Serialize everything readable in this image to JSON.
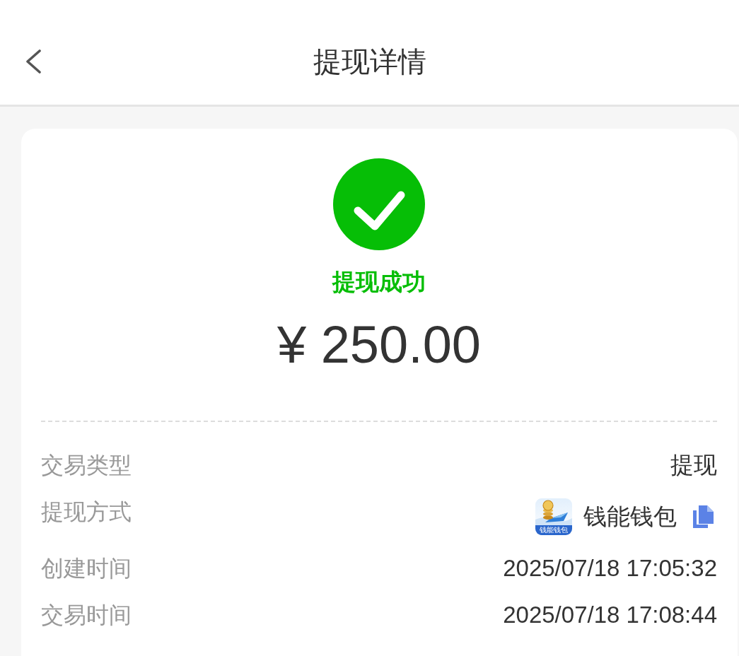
{
  "header": {
    "title": "提现详情"
  },
  "status": {
    "kind": "success",
    "label": "提现成功"
  },
  "amount": "¥ 250.00",
  "details": [
    {
      "kind": "text",
      "label": "交易类型",
      "value": "提现",
      "copyable": false
    },
    {
      "kind": "method",
      "label": "提现方式",
      "logo_text": "钱能钱包",
      "value": "钱能钱包",
      "copyable": true
    },
    {
      "kind": "text",
      "label": "创建时间",
      "value": "2025/07/18 17:05:32",
      "copyable": false
    },
    {
      "kind": "text",
      "label": "交易时间",
      "value": "2025/07/18 17:08:44",
      "copyable": false
    }
  ]
}
